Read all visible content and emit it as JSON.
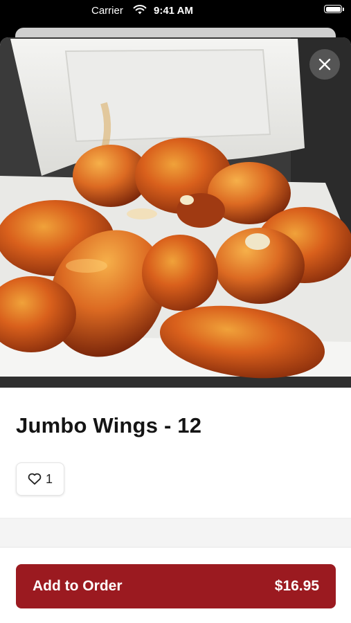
{
  "status_bar": {
    "carrier": "Carrier",
    "time": "9:41 AM"
  },
  "item": {
    "name": "Jumbo Wings - 12",
    "likes": "1",
    "image_alt": "Jumbo wings in a foam takeout container"
  },
  "order": {
    "add_label": "Add to Order",
    "price": "$16.95"
  },
  "colors": {
    "accent": "#9b1a20",
    "sheet_background": "#ffffff"
  },
  "icons": {
    "close": "close-icon",
    "like": "heart-icon",
    "wifi": "wifi-icon",
    "battery": "battery-icon"
  }
}
